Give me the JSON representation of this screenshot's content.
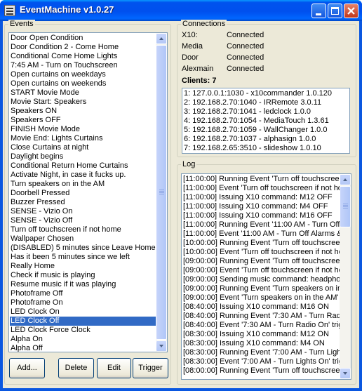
{
  "window": {
    "title": "EventMachine v1.0.27"
  },
  "events": {
    "label": "Events",
    "items": [
      "Door Open Condition",
      "Door Condition 2 - Come Home",
      "Conditional Come Home Lights",
      "7:45 AM - Turn on Touchscreen",
      "Open curtains on weekdays",
      "Open curtains on weekends",
      "START Movie Mode",
      "Movie Start: Speakers",
      "Speakers ON",
      "Speakers OFF",
      "FINISH Movie Mode",
      "Movie End: Lights Curtains",
      "Close Curtains at night",
      "Daylight begins",
      "Conditional Return Home Curtains",
      "Activate Night, in case it fucks up.",
      "Turn speakers on in the AM",
      "Doorbell Pressed",
      "Buzzer Pressed",
      "SENSE - Vizio On",
      "SENSE - Vizio Off",
      "Turn off touchscreen if not home",
      "Wallpaper Chosen",
      "(DISABLED) 5 minutes since Leave Home",
      "Has it been 5 minutes since we left",
      "Really Home",
      "Check if music is playing",
      "Resume music if it was playing",
      "Photoframe Off",
      "Photoframe On",
      "LED Clock On",
      "LED Clock Off",
      "LED Clock Force Clock",
      "Alpha On",
      "Alpha Off"
    ],
    "selected_index": 31,
    "buttons": {
      "add": "Add...",
      "delete": "Delete",
      "edit": "Edit",
      "trigger": "Trigger"
    }
  },
  "connections": {
    "label": "Connections",
    "rows": [
      {
        "name": "X10:",
        "status": "Connected"
      },
      {
        "name": "Media",
        "status": "Connected"
      },
      {
        "name": "Door",
        "status": "Connected"
      },
      {
        "name": "Alexmain",
        "status": "Connected"
      }
    ],
    "clients_label": "Clients: 7",
    "clients": [
      "1: 127.0.0.1:1030 - x10commander 1.0.120",
      "2: 192.168.2.70:1040 - IRRemote 3.0.11",
      "3: 192.168.2.70:1041 - ledclock 1.0.0",
      "4: 192.168.2.70:1054 - MediaTouch 1.3.61",
      "5: 192.168.2.70:1059 - WallChanger 1.0.0",
      "6: 192.168.2.70:1037 - alphasign 1.0.0",
      "7: 192.168.2.65:3510 - slideshow 1.0.10"
    ]
  },
  "log": {
    "label": "Log",
    "lines": [
      "[11:00:00] Running Event 'Turn off touchscreen",
      "[11:00:00] Event 'Turn off touchscreen if not ho",
      "[11:00:00] Issuing X10 command: M12 OFF",
      "[11:00:00] Issuing X10 command: M4 OFF",
      "[11:00:00] Issuing X10 command: M16 OFF",
      "[11:00:00] Running Event '11:00 AM - Turn Off",
      "[11:00:00] Event '11:00 AM - Turn Off Alarms &",
      "[10:00:00] Running Event 'Turn off touchscreen",
      "[10:00:00] Event 'Turn off touchscreen if not ho",
      "[09:00:00] Running Event 'Turn off touchscreen",
      "[09:00:00] Event 'Turn off touchscreen if not ho",
      "[09:00:00] Sending music command: headphor",
      "[09:00:00] Running Event 'Turn speakers on in",
      "[09:00:00] Event 'Turn speakers on in the AM' t",
      "[08:40:00] Issuing X10 command: M16 ON",
      "[08:40:00] Running Event '7:30 AM - Turn Rad",
      "[08:40:00] Event '7:30 AM - Turn Radio On' trig",
      "[08:30:00] Issuing X10 command: M12 ON",
      "[08:30:00] Issuing X10 command: M4 ON",
      "[08:30:00] Running Event '7:00 AM - Turn Ligh",
      "[08:30:00] Event '7:00 AM - Turn Lights On' trig",
      "[08:00:00] Running Event 'Turn off touchscreen"
    ]
  }
}
